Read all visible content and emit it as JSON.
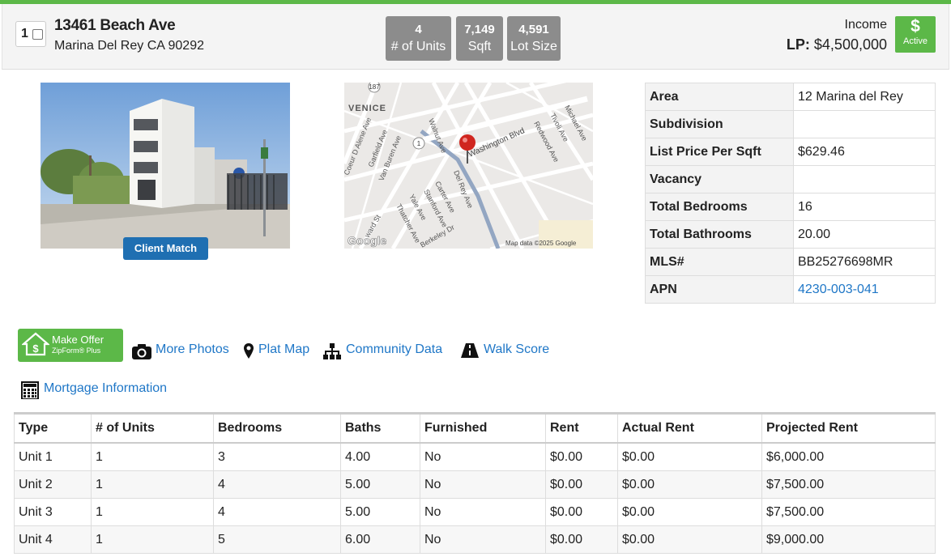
{
  "listing": {
    "select_number": "1",
    "address_line1": "13461 Beach Ave",
    "address_line2": "Marina Del Rey CA 90292",
    "stats": [
      {
        "value": "4",
        "label": "# of Units"
      },
      {
        "value": "7,149",
        "label": "Sqft"
      },
      {
        "value": "4,591",
        "label": "Lot Size"
      }
    ],
    "type_label": "Income",
    "lp_label": "LP:",
    "lp_value": "$4,500,000",
    "status_symbol": "$",
    "status_label": "Active"
  },
  "photo": {
    "button_label": "Client Match"
  },
  "map": {
    "labels": {
      "venice": "VENICE",
      "washington": "Washington Blvd",
      "coeur": "Coeur D Alene Ave",
      "garfield": "Garfield Ave",
      "vanburen": "Van Buren Ave",
      "walnut": "Walnut Ave",
      "delrey": "Del Rey Ave",
      "carter": "Carter Ave",
      "stanford": "Stanford Ave",
      "yale": "Yale Ave",
      "thatcher": "Thatcher Ave",
      "berkeley": "Berkeley Dr",
      "ward": "ward St",
      "redwood": "Redwood Ave",
      "tivoli": "Tivoli Ave",
      "michael": "Michael Ave",
      "hwy187": "187",
      "hwy1": "1",
      "google": "Google",
      "mapdata": "Map data ©2025 Google"
    }
  },
  "details": [
    {
      "label": "Area",
      "value": "12 Marina del Rey"
    },
    {
      "label": "Subdivision",
      "value": ""
    },
    {
      "label": "List Price Per Sqft",
      "value": "$629.46"
    },
    {
      "label": "Vacancy",
      "value": ""
    },
    {
      "label": "Total Bedrooms",
      "value": "16"
    },
    {
      "label": "Total Bathrooms",
      "value": "20.00"
    },
    {
      "label": "MLS#",
      "value": "BB25276698MR"
    },
    {
      "label": "APN",
      "value": "4230-003-041"
    }
  ],
  "actions": {
    "make_offer": "Make Offer",
    "make_offer_sub": "ZipForm® Plus",
    "more_photos": "More Photos",
    "plat_map": "Plat Map",
    "community_data": "Community Data",
    "walk_score": "Walk Score",
    "mortgage": "Mortgage Information"
  },
  "units_table": {
    "headers": [
      "Type",
      "# of Units",
      "Bedrooms",
      "Baths",
      "Furnished",
      "Rent",
      "Actual Rent",
      "Projected Rent"
    ],
    "rows": [
      [
        "Unit 1",
        "1",
        "3",
        "4.00",
        "No",
        "$0.00",
        "$0.00",
        "$6,000.00"
      ],
      [
        "Unit 2",
        "1",
        "4",
        "5.00",
        "No",
        "$0.00",
        "$0.00",
        "$7,500.00"
      ],
      [
        "Unit 3",
        "1",
        "4",
        "5.00",
        "No",
        "$0.00",
        "$0.00",
        "$7,500.00"
      ],
      [
        "Unit 4",
        "1",
        "5",
        "6.00",
        "No",
        "$0.00",
        "$0.00",
        "$9,000.00"
      ]
    ]
  },
  "colors": {
    "accent_green": "#5cb848",
    "link_blue": "#1f77c7",
    "stat_gray": "#8c8c8c"
  }
}
